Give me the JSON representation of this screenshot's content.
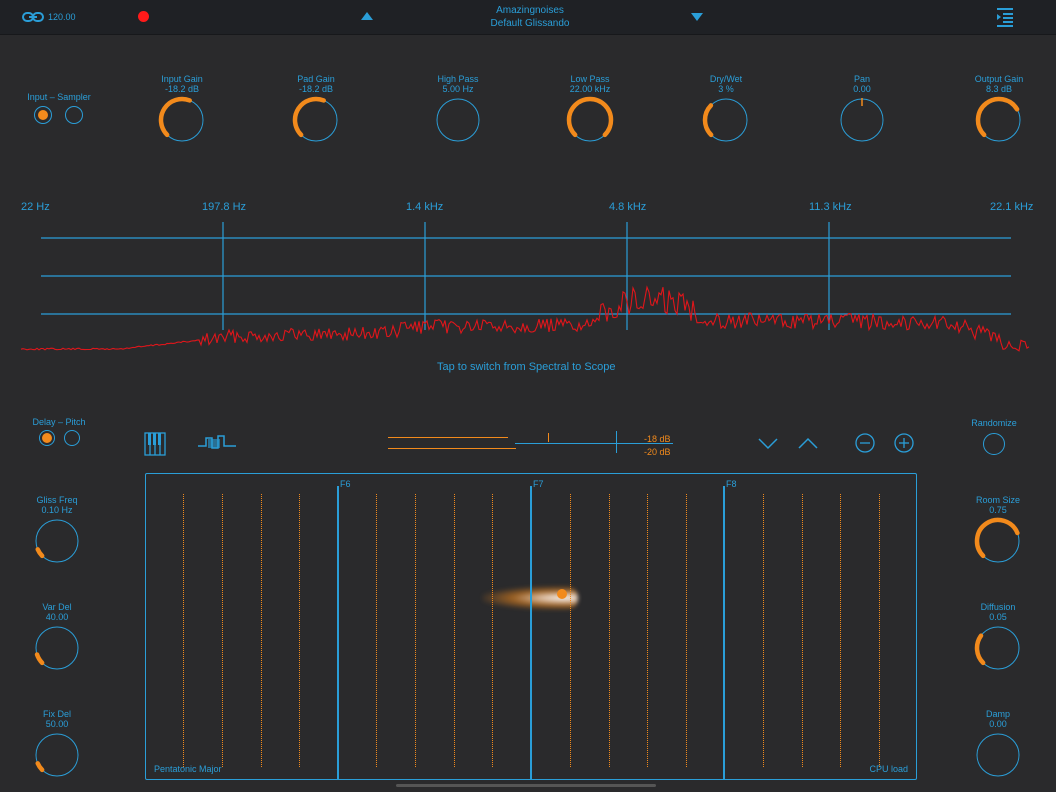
{
  "header": {
    "tempo": "120.00",
    "app_name": "Amazingnoises",
    "preset_name": "Default Glissando",
    "link_icon": "link-icon",
    "record_icon": "record-icon",
    "prev_icon": "triangle-up-icon",
    "next_icon": "triangle-down-icon",
    "menu_icon": "menu-list-icon"
  },
  "colors": {
    "accent": "#f28a1c",
    "blue": "#2a9ed8",
    "spectrum": "#e0161b",
    "bg": "#2a2a2c"
  },
  "input_switch": {
    "label": "Input – Sampler",
    "selected": 0
  },
  "delay_switch": {
    "label": "Delay – Pitch",
    "selected": 0
  },
  "knobs_top": [
    {
      "title": "Input Gain",
      "value": "-18.2 dB",
      "level": 0.58
    },
    {
      "title": "Pad Gain",
      "value": "-18.2 dB",
      "level": 0.58
    },
    {
      "title": "High Pass",
      "value": "5.00 Hz",
      "level": 0.0
    },
    {
      "title": "Low Pass",
      "value": "22.00 kHz",
      "level": 1.0
    },
    {
      "title": "Dry/Wet",
      "value": "3 %",
      "level": 0.33
    },
    {
      "title": "Pan",
      "value": "0.00",
      "level": 0.5
    },
    {
      "title": "Output Gain",
      "value": "8.3 dB",
      "level": 0.72
    }
  ],
  "spectrum": {
    "freq_labels": [
      "22 Hz",
      "197.8 Hz",
      "1.4 kHz",
      "4.8 kHz",
      "11.3 kHz",
      "22.1 kHz"
    ],
    "hint": "Tap to switch from Spectral to Scope"
  },
  "toolbar": {
    "keyboard_icon": "piano-keys-icon",
    "waveform_icon": "step-waveform-icon",
    "meter_top": "-18 dB",
    "meter_bottom": "-20 dB",
    "down_icon": "chevron-down-icon",
    "up_icon": "chevron-up-icon",
    "minus_icon": "minus-circle-icon",
    "plus_icon": "plus-circle-icon"
  },
  "randomize": {
    "label": "Randomize"
  },
  "knobs_left": [
    {
      "title": "Gliss Freq",
      "value": "0.10 Hz",
      "level": 0.08
    },
    {
      "title": "Var Del",
      "value": "40.00",
      "level": 0.1
    },
    {
      "title": "Fix Del",
      "value": "50.00",
      "level": 0.08
    }
  ],
  "knobs_right": [
    {
      "title": "Room Size",
      "value": "0.75",
      "level": 0.75
    },
    {
      "title": "Diffusion",
      "value": "0.05",
      "level": 0.3
    },
    {
      "title": "Damp",
      "value": "0.00",
      "level": 0.0
    }
  ],
  "pad": {
    "notes": [
      "F6",
      "F7",
      "F8"
    ],
    "scale": "Pentatonic Major",
    "cpu": "CPU load"
  }
}
